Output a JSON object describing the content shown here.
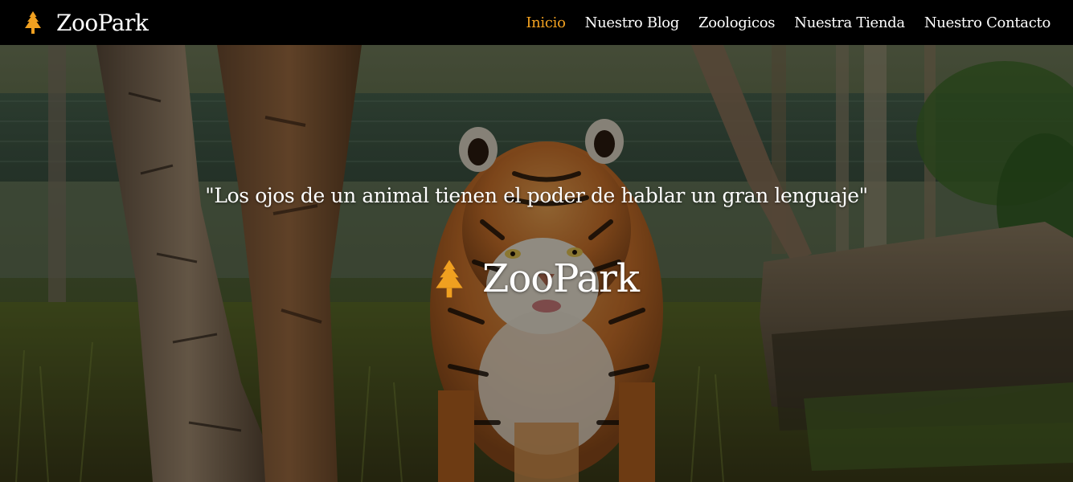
{
  "navbar": {
    "brand": {
      "icon": "tree-icon",
      "name": "ZooPark"
    },
    "links": [
      {
        "label": "Inicio",
        "active": true
      },
      {
        "label": "Nuestro Blog",
        "active": false
      },
      {
        "label": "Zoologicos",
        "active": false
      },
      {
        "label": "Nuestra Tienda",
        "active": false
      },
      {
        "label": "Nuestro Contacto",
        "active": false
      }
    ]
  },
  "hero": {
    "background": "tiger-photo",
    "quote": "\"Los ojos de un animal tienen el poder de hablar un gran lenguaje\"",
    "brand": {
      "icon": "tree-icon",
      "name": "ZooPark"
    }
  },
  "colors": {
    "navbar_bg": "#000000",
    "accent": "#f0a020",
    "text": "#ffffff"
  }
}
